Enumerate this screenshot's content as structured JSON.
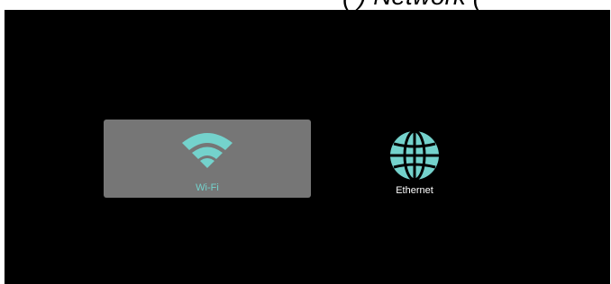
{
  "header": {
    "title": "(   )    Network       ("
  },
  "network_options": [
    {
      "label": "Wi-Fi",
      "icon": "wifi-icon",
      "selected": true
    },
    {
      "label": "Ethernet",
      "icon": "globe-icon",
      "selected": false
    }
  ],
  "colors": {
    "background": "#000000",
    "selected_tile": "#767676",
    "icon_accent": "#74d2cc",
    "text": "#ffffff"
  }
}
